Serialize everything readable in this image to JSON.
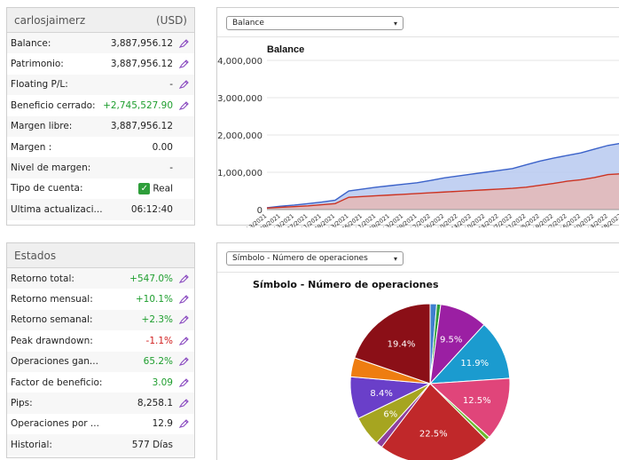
{
  "account": {
    "name": "carlosjaimerz",
    "currency": "(USD)",
    "rows": [
      {
        "label": "Balance:",
        "value": "3,887,956.12",
        "color": "",
        "edit": true
      },
      {
        "label": "Patrimonio:",
        "value": "3,887,956.12",
        "color": "",
        "edit": true
      },
      {
        "label": "Floating P/L:",
        "value": "-",
        "color": "",
        "edit": true
      },
      {
        "label": "Beneficio cerrado:",
        "value": "+2,745,527.90",
        "color": "pos",
        "edit": true
      },
      {
        "label": "Margen libre:",
        "value": "3,887,956.12",
        "color": "",
        "edit": false
      },
      {
        "label": "Margen :",
        "value": "0.00",
        "color": "",
        "edit": false
      },
      {
        "label": "Nivel de margen:",
        "value": "-",
        "color": "",
        "edit": false
      },
      {
        "label": "Tipo de cuenta:",
        "value": "Real",
        "color": "",
        "edit": false,
        "check": true
      },
      {
        "label": "Ultima actualizaci...",
        "value": "06:12:40",
        "color": "",
        "edit": false
      }
    ]
  },
  "stats": {
    "title": "Estados",
    "rows": [
      {
        "label": "Retorno total:",
        "value": "+547.0%",
        "color": "pos",
        "edit": true
      },
      {
        "label": "Retorno mensual:",
        "value": "+10.1%",
        "color": "pos",
        "edit": true
      },
      {
        "label": "Retorno semanal:",
        "value": "+2.3%",
        "color": "pos",
        "edit": true
      },
      {
        "label": "Peak drawndown:",
        "value": "-1.1%",
        "color": "neg",
        "edit": true
      },
      {
        "label": "Operaciones gan...",
        "value": "65.2%",
        "color": "pos",
        "edit": true
      },
      {
        "label": "Factor de beneficio:",
        "value": "3.09",
        "color": "pos",
        "edit": true
      },
      {
        "label": "Pips:",
        "value": "8,258.1",
        "color": "",
        "edit": true
      },
      {
        "label": "Operaciones por ...",
        "value": "12.9",
        "color": "",
        "edit": true
      },
      {
        "label": "Historial:",
        "value": "577 Días",
        "color": "",
        "edit": false
      }
    ]
  },
  "balance_chart": {
    "selector": "Balance",
    "chart_data": {
      "type": "area",
      "title": "Balance",
      "y_ticks": [
        "4,000,000",
        "3,000,000",
        "2,000,000",
        "1,000,000",
        "0"
      ],
      "ylim": [
        0,
        4000000
      ],
      "x_ticks": [
        "7/13/2021",
        "7/29/2021",
        "8/13/2021",
        "8/27/2021",
        "9/11/2021",
        "9/29/2021",
        "10/13/2021",
        "10/26/2021",
        "11/11/2021",
        "11/29/2021",
        "12/13/2021",
        "12/29/2021",
        "1/12/2022",
        "1/26/2022",
        "2/10/2022",
        "2/24/2022",
        "3/10/2022",
        "3/24/2022",
        "4/7/2022",
        "4/21/2022",
        "5/5/2022",
        "5/19/2022",
        "6/2/2022",
        "6/16/2022",
        "6/30/2022",
        "7/14/2022",
        "7/28/2022"
      ],
      "series": [
        {
          "color": "#3b62c9",
          "fill": "#b7c9f0",
          "values": [
            50000,
            90000,
            120000,
            160000,
            200000,
            250000,
            500000,
            550000,
            600000,
            640000,
            680000,
            720000,
            780000,
            850000,
            900000,
            950000,
            1000000,
            1050000,
            1100000,
            1200000,
            1300000,
            1380000,
            1450000,
            1520000,
            1620000,
            1720000,
            1780000
          ]
        },
        {
          "color": "#cc3322",
          "fill": "#e9b4ad",
          "values": [
            40000,
            60000,
            80000,
            100000,
            130000,
            160000,
            330000,
            350000,
            370000,
            390000,
            410000,
            430000,
            450000,
            470000,
            490000,
            510000,
            530000,
            550000,
            570000,
            600000,
            650000,
            700000,
            760000,
            800000,
            860000,
            940000,
            960000
          ]
        }
      ]
    }
  },
  "pie_chart": {
    "selector": "Símbolo - Número de operaciones",
    "chart_data": {
      "type": "pie",
      "title": "Símbolo - Número de operaciones",
      "slices": [
        {
          "value": 1.3,
          "color": "#3f7fcf",
          "label": ""
        },
        {
          "value": 0.8,
          "color": "#2e9e3a",
          "label": ""
        },
        {
          "value": 9.5,
          "color": "#9b1fa3",
          "label": "9.5%"
        },
        {
          "value": 11.9,
          "color": "#1b9bcf",
          "label": "11.9%"
        },
        {
          "value": 12.5,
          "color": "#e0457a",
          "label": "12.5%"
        },
        {
          "value": 0.8,
          "color": "#6dba2c",
          "label": ""
        },
        {
          "value": 22.5,
          "color": "#c0282a",
          "label": "22.5%"
        },
        {
          "value": 1.3,
          "color": "#8d3f9e",
          "label": ""
        },
        {
          "value": 6.0,
          "color": "#a6a520",
          "label": "6%"
        },
        {
          "value": 8.4,
          "color": "#6a3fc9",
          "label": "8.4%"
        },
        {
          "value": 3.8,
          "color": "#ee7d11",
          "label": ""
        },
        {
          "value": 19.4,
          "color": "#8b0f17",
          "label": "19.4%"
        }
      ]
    }
  }
}
